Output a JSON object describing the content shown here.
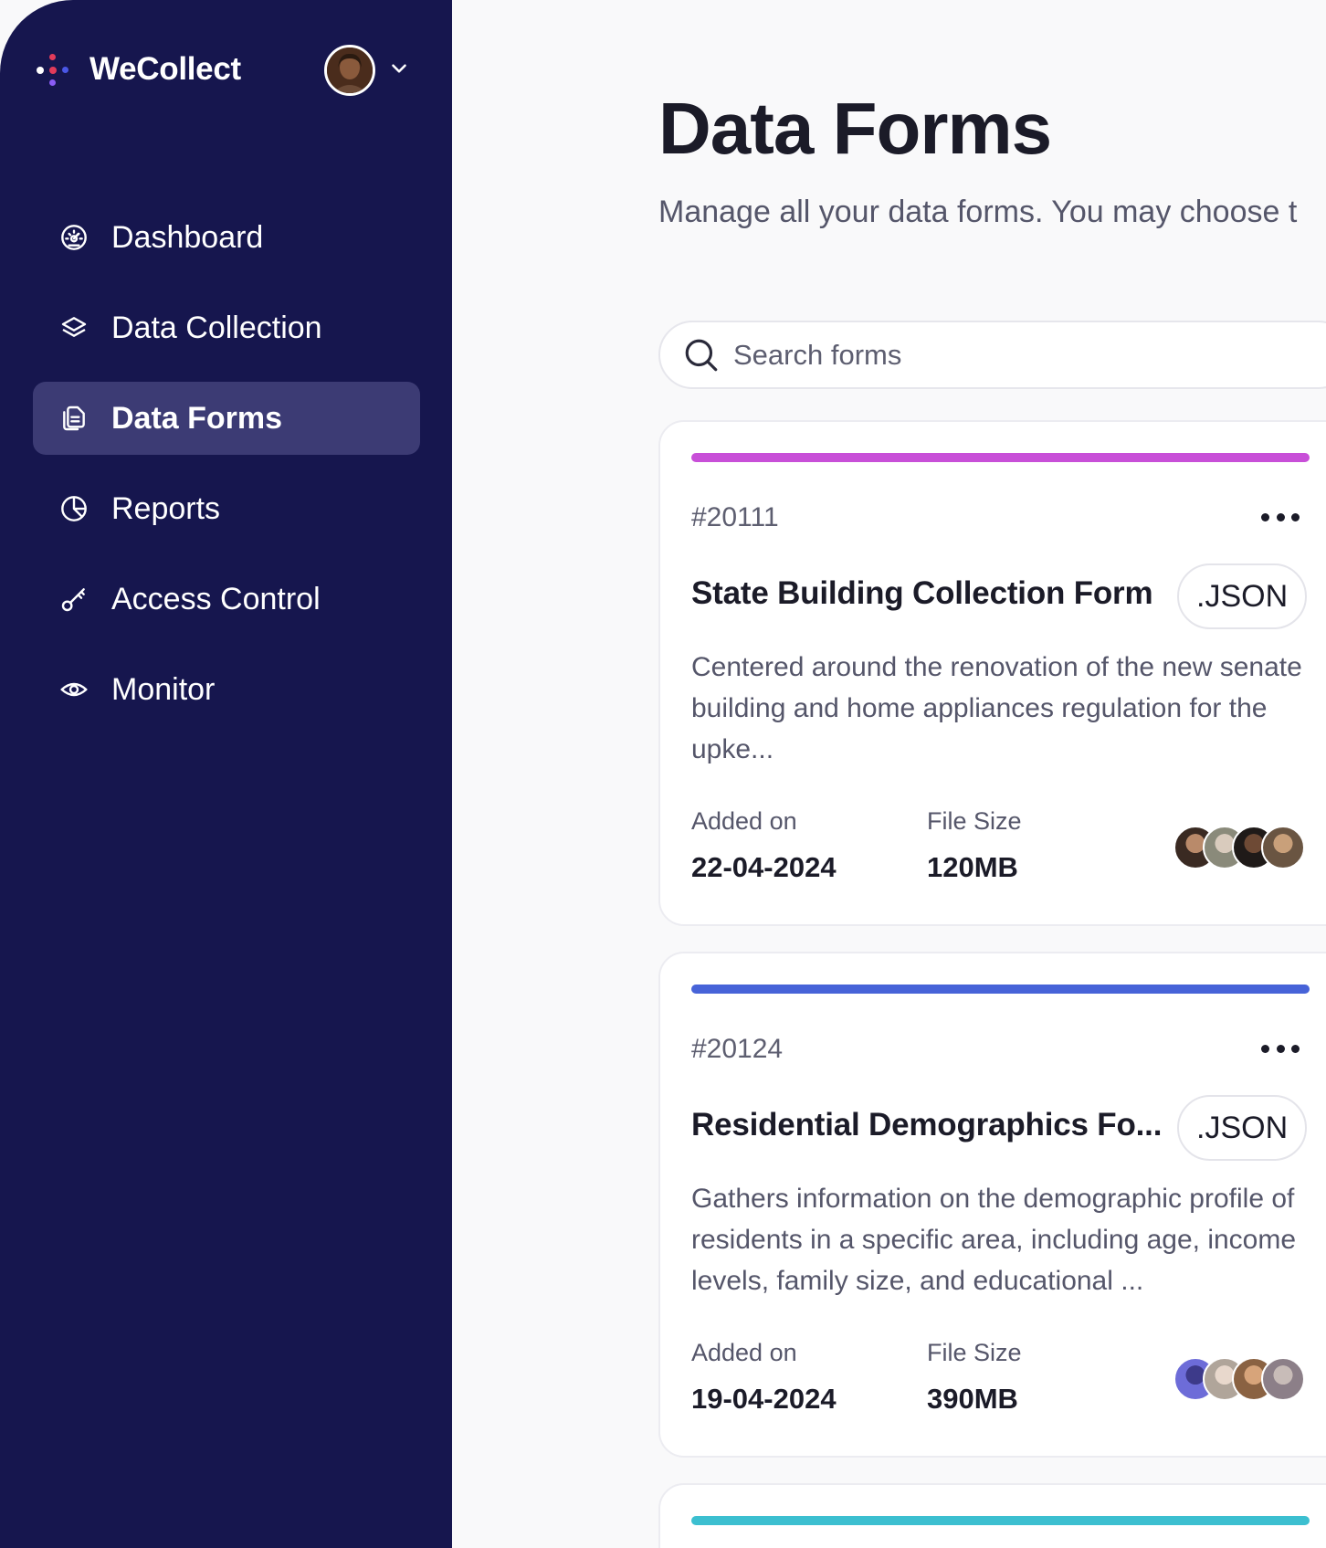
{
  "brand": {
    "name": "WeCollect",
    "logo_colors": [
      "#ffffff",
      "#e23b5a",
      "#4a57e6",
      "#8b5cf6"
    ]
  },
  "user": {
    "avatar_icon": "user-avatar",
    "menu_icon": "chevron-down-icon"
  },
  "sidebar": {
    "items": [
      {
        "label": "Dashboard",
        "icon": "dashboard-icon"
      },
      {
        "label": "Data Collection",
        "icon": "layers-icon"
      },
      {
        "label": "Data Forms",
        "icon": "documents-icon",
        "active": true
      },
      {
        "label": "Reports",
        "icon": "pie-chart-icon"
      },
      {
        "label": "Access Control",
        "icon": "key-icon"
      },
      {
        "label": "Monitor",
        "icon": "eye-icon"
      }
    ]
  },
  "main": {
    "title": "Data Forms",
    "subtitle": "Manage all your data forms. You may choose t",
    "search": {
      "placeholder": "Search forms",
      "value": ""
    },
    "cards": [
      {
        "id": "#20111",
        "title": "State Building Collection Form",
        "badge": ".JSON",
        "description": "Centered around the renovation of the new senate building and home appliances regulation for the upke...",
        "added_label": "Added on",
        "added_value": "22-04-2024",
        "size_label": "File Size",
        "size_value": "120MB",
        "accent": "#c84fd8"
      },
      {
        "id": "#20124",
        "title": "Residential Demographics Fo...",
        "badge": ".JSON",
        "description": "Gathers information on the demographic profile of residents in a specific area, including age, income levels, family size, and educational ...",
        "added_label": "Added on",
        "added_value": "19-04-2024",
        "size_label": "File Size",
        "size_value": "390MB",
        "accent": "#4763d8"
      },
      {
        "accent": "#3cbfd0"
      }
    ]
  },
  "colors": {
    "sidebar_bg": "#16164e",
    "active_item_bg": "#3c3b74",
    "page_bg": "#f9f9fa"
  }
}
